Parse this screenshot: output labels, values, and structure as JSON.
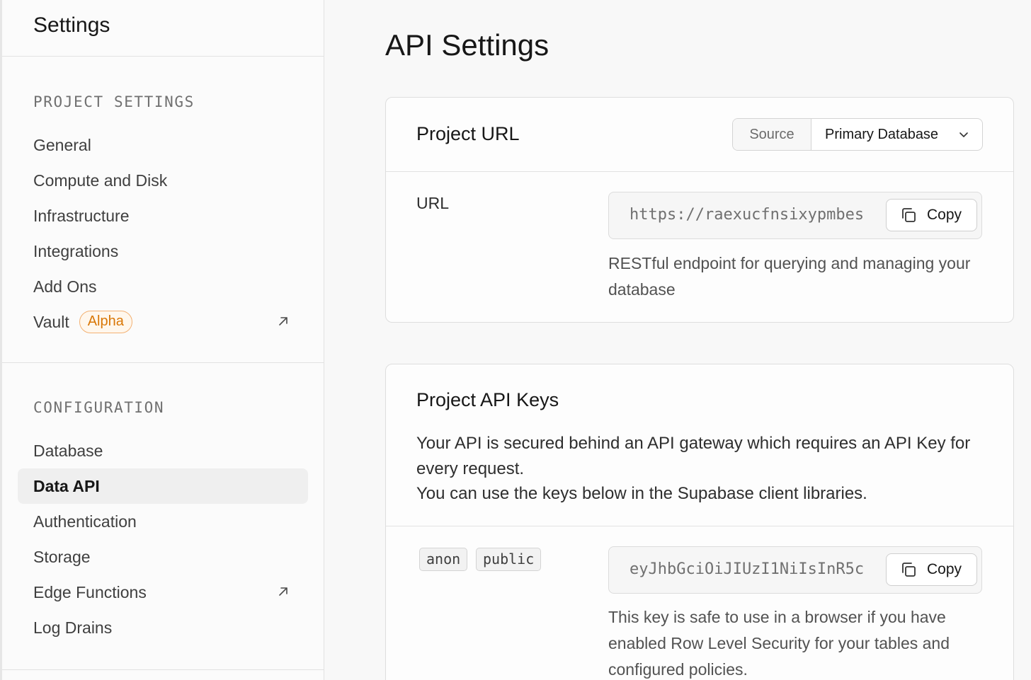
{
  "sidebar": {
    "title": "Settings",
    "sections": [
      {
        "label": "PROJECT SETTINGS",
        "items": [
          {
            "label": "General"
          },
          {
            "label": "Compute and Disk"
          },
          {
            "label": "Infrastructure"
          },
          {
            "label": "Integrations"
          },
          {
            "label": "Add Ons"
          },
          {
            "label": "Vault",
            "badge": "Alpha",
            "external": true
          }
        ]
      },
      {
        "label": "CONFIGURATION",
        "items": [
          {
            "label": "Database"
          },
          {
            "label": "Data API",
            "active": true
          },
          {
            "label": "Authentication"
          },
          {
            "label": "Storage"
          },
          {
            "label": "Edge Functions",
            "external": true
          },
          {
            "label": "Log Drains"
          }
        ]
      }
    ]
  },
  "main": {
    "title": "API Settings",
    "project_url": {
      "title": "Project URL",
      "source_label": "Source",
      "source_value": "Primary Database",
      "url_label": "URL",
      "url_value": "https://raexucfnsixypmbes",
      "copy_label": "Copy",
      "help": "RESTful endpoint for querying and managing your database"
    },
    "api_keys": {
      "title": "Project API Keys",
      "description_line1": "Your API is secured behind an API gateway which requires an API Key for every request.",
      "description_line2": "You can use the keys below in the Supabase client libraries.",
      "tags": [
        "anon",
        "public"
      ],
      "key_value": "eyJhbGciOiJIUzI1NiIsInR5c",
      "copy_label": "Copy",
      "help": "This key is safe to use in a browser if you have enabled Row Level Security for your tables and configured policies."
    }
  },
  "colors": {
    "badge_orange": "#d97706",
    "active_bg": "#efefef"
  },
  "icons": {
    "external": "external-link-icon",
    "copy": "copy-icon",
    "chevron": "chevron-down-icon"
  }
}
